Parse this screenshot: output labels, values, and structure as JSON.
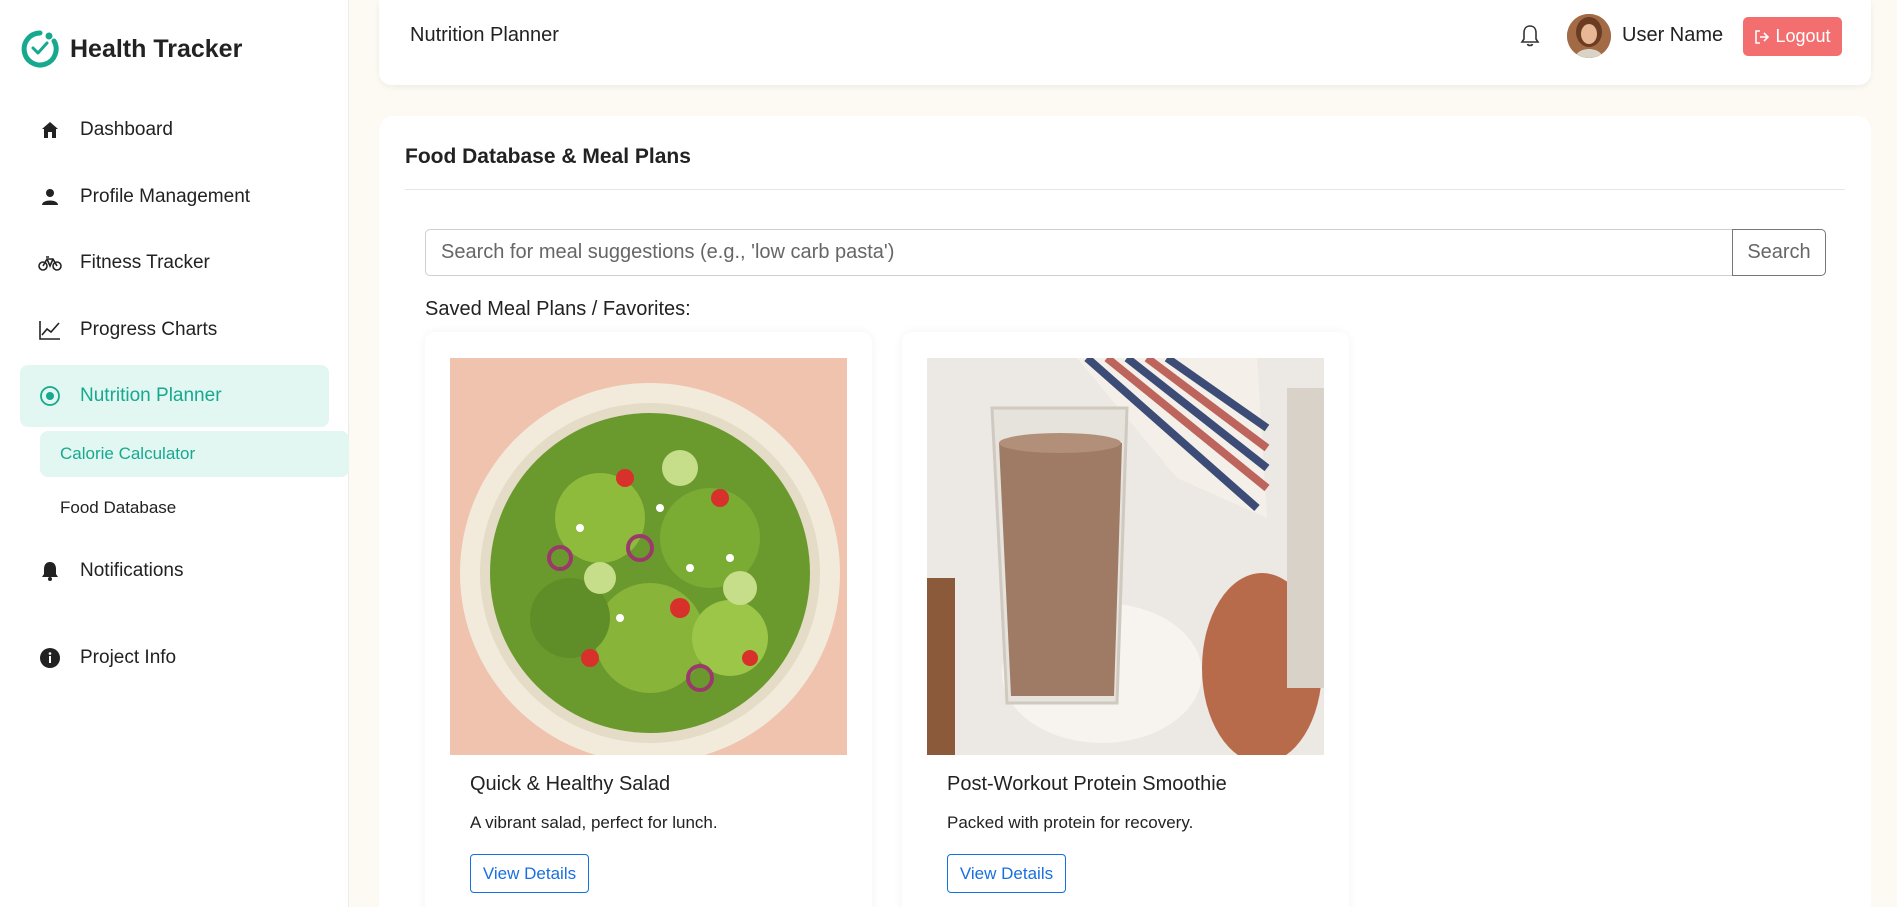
{
  "app": {
    "brand": "Health Tracker"
  },
  "sidebar": {
    "items": [
      {
        "label": "Dashboard",
        "icon": "home-icon"
      },
      {
        "label": "Profile Management",
        "icon": "user-icon"
      },
      {
        "label": "Fitness Tracker",
        "icon": "bicycle-icon"
      },
      {
        "label": "Progress Charts",
        "icon": "chart-line-icon"
      },
      {
        "label": "Nutrition Planner",
        "icon": "nutrition-icon",
        "active": true
      },
      {
        "label": "Notifications",
        "icon": "bell-icon"
      },
      {
        "label": "Project Info",
        "icon": "info-icon"
      }
    ],
    "subitems": [
      {
        "label": "Calorie Calculator",
        "active": true
      },
      {
        "label": "Food Database"
      }
    ]
  },
  "header": {
    "title": "Nutrition Planner",
    "user_name": "User Name",
    "logout_label": "Logout"
  },
  "main": {
    "title": "Food Database & Meal Plans",
    "search": {
      "placeholder": "Search for meal suggestions (e.g., 'low carb pasta')",
      "button_label": "Search"
    },
    "saved_label": "Saved Meal Plans / Favorites:",
    "meals": [
      {
        "name": "Quick & Healthy Salad",
        "description": "A vibrant salad, perfect for lunch.",
        "button_label": "View Details"
      },
      {
        "name": "Post-Workout Protein Smoothie",
        "description": "Packed with protein for recovery.",
        "button_label": "View Details"
      }
    ]
  },
  "colors": {
    "accent": "#17a98f",
    "active_bg": "#e2f6f2",
    "logout": "#f36f6f",
    "link": "#1a6fe0",
    "page_bg": "#fdf9f3"
  }
}
